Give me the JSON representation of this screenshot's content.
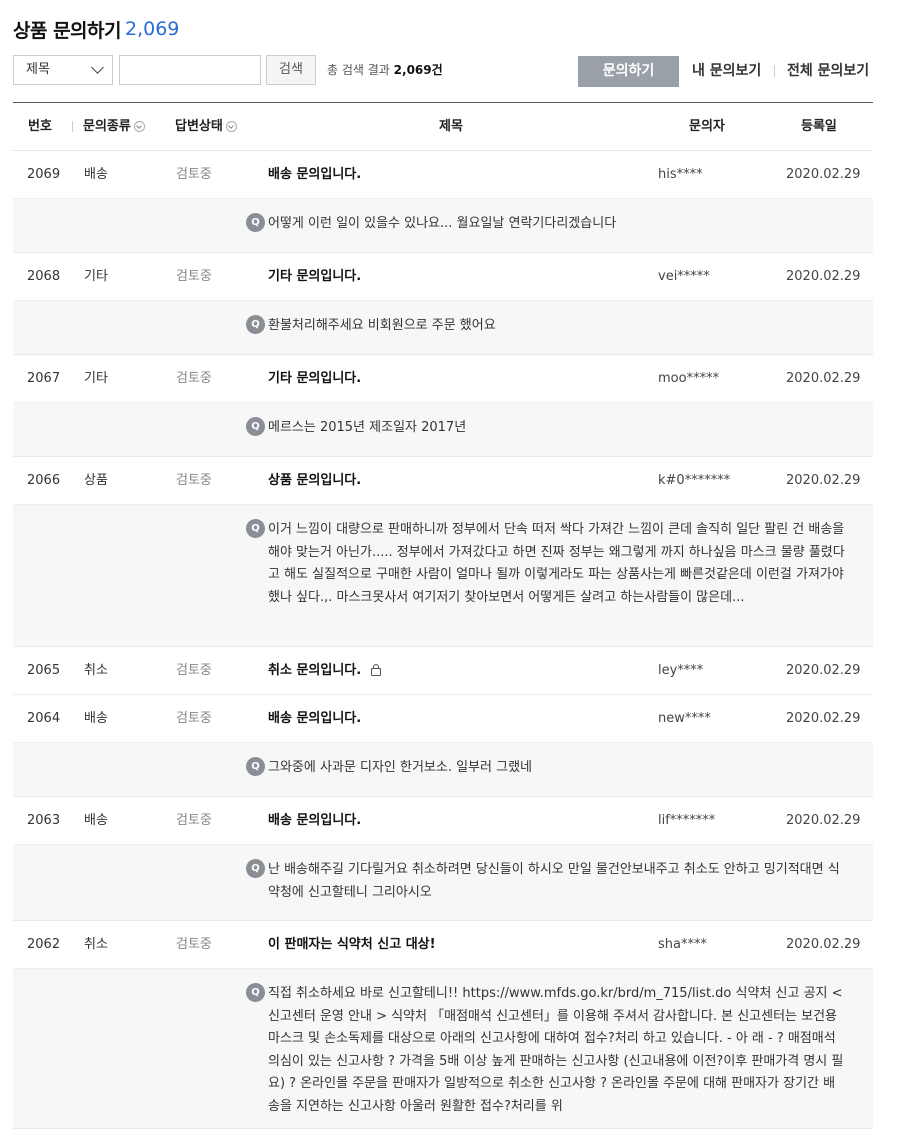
{
  "header": {
    "title": "상품 문의하기",
    "count": "2,069"
  },
  "toolbar": {
    "select_value": "제목",
    "search_placeholder": "",
    "search_label": "검색",
    "result_prefix": "총 검색 결과",
    "result_count": "2,069건",
    "ask_label": "문의하기",
    "my_label": "내 문의보기",
    "all_label": "전체 문의보기"
  },
  "columns": {
    "num": "번호",
    "type": "문의종류",
    "status": "답변상태",
    "subject": "제목",
    "author": "문의자",
    "date": "등록일"
  },
  "rows": [
    {
      "num": "2069",
      "type": "배송",
      "status": "검토중",
      "subject": "배송 문의입니다.",
      "author": "his****",
      "date": "2020.02.29",
      "question": "어떻게 이런 일이 있을수 있나요... 월요일날 연락기다리겠습니다"
    },
    {
      "num": "2068",
      "type": "기타",
      "status": "검토중",
      "subject": "기타 문의입니다.",
      "author": "vei*****",
      "date": "2020.02.29",
      "question": "환불처리해주세요 비회원으로 주문 했어요"
    },
    {
      "num": "2067",
      "type": "기타",
      "status": "검토중",
      "subject": "기타 문의입니다.",
      "author": "moo*****",
      "date": "2020.02.29",
      "question": "메르스는 2015년 제조일자 2017년"
    },
    {
      "num": "2066",
      "type": "상품",
      "status": "검토중",
      "subject": "상품 문의입니다.",
      "author": "k#0*******",
      "date": "2020.02.29",
      "question": "이거 느낌이 대량으로 판매하니까 정부에서 단속 떠저 싹다 가져간 느낌이 큰데 솔직히 일단 팔린 건 배송을 해야 맞는거 아닌가..... 정부에서 가져갔다고 하면 진짜 정부는 왜그렇게 까지 하나싶음 마스크 물량 풀렸다고 해도 실질적으로 구매한 사람이 얼마나 될까 이렇게라도 파는 상품사는게 빠른것같은데 이런걸 가져가야 했나 싶다.,. 마스크못사서 여기저기 찾아보면서 어떻게든 살려고 하는사람들이 많은데..."
    },
    {
      "num": "2065",
      "type": "취소",
      "status": "검토중",
      "subject": "취소 문의입니다.",
      "author": "ley****",
      "date": "2020.02.29",
      "locked": true
    },
    {
      "num": "2064",
      "type": "배송",
      "status": "검토중",
      "subject": "배송 문의입니다.",
      "author": "new****",
      "date": "2020.02.29",
      "question": "그와중에 사과문 디자인 한거보소. 일부러 그랬네"
    },
    {
      "num": "2063",
      "type": "배송",
      "status": "검토중",
      "subject": "배송 문의입니다.",
      "author": "lif*******",
      "date": "2020.02.29",
      "question": "난 배송해주길 기다릴거요 취소하려면 당신들이 하시오 만일 물건안보내주고 취소도 안하고 밍기적대면 식약청에 신고할테니 그리아시오"
    },
    {
      "num": "2062",
      "type": "취소",
      "status": "검토중",
      "subject": "이 판매자는 식약처 신고 대상!",
      "author": "sha****",
      "date": "2020.02.29",
      "question": "직접 취소하세요 바로 신고할테니!! https://www.mfds.go.kr/brd/m_715/list.do 식약처 신고 공지 < 신고센터 운영 안내 > 식약처 「매점매석 신고센터」를 이용해 주셔서 감사합니다. 본 신고센터는 보건용 마스크 및 손소독제를 대상으로 아래의 신고사항에 대하여 접수?처리 하고 있습니다. - 아 래 - ? 매점매석 의심이 있는 신고사항 ? 가격을 5배 이상 높게 판매하는 신고사항 (신고내용에 이전?이후 판매가격 명시 필요) ? 온라인몰 주문을 판매자가 일방적으로 취소한 신고사항 ? 온라인몰 주문에 대해 판매자가 장기간 배송을 지연하는 신고사항 아울러 원활한 접수?처리를 위"
    }
  ]
}
